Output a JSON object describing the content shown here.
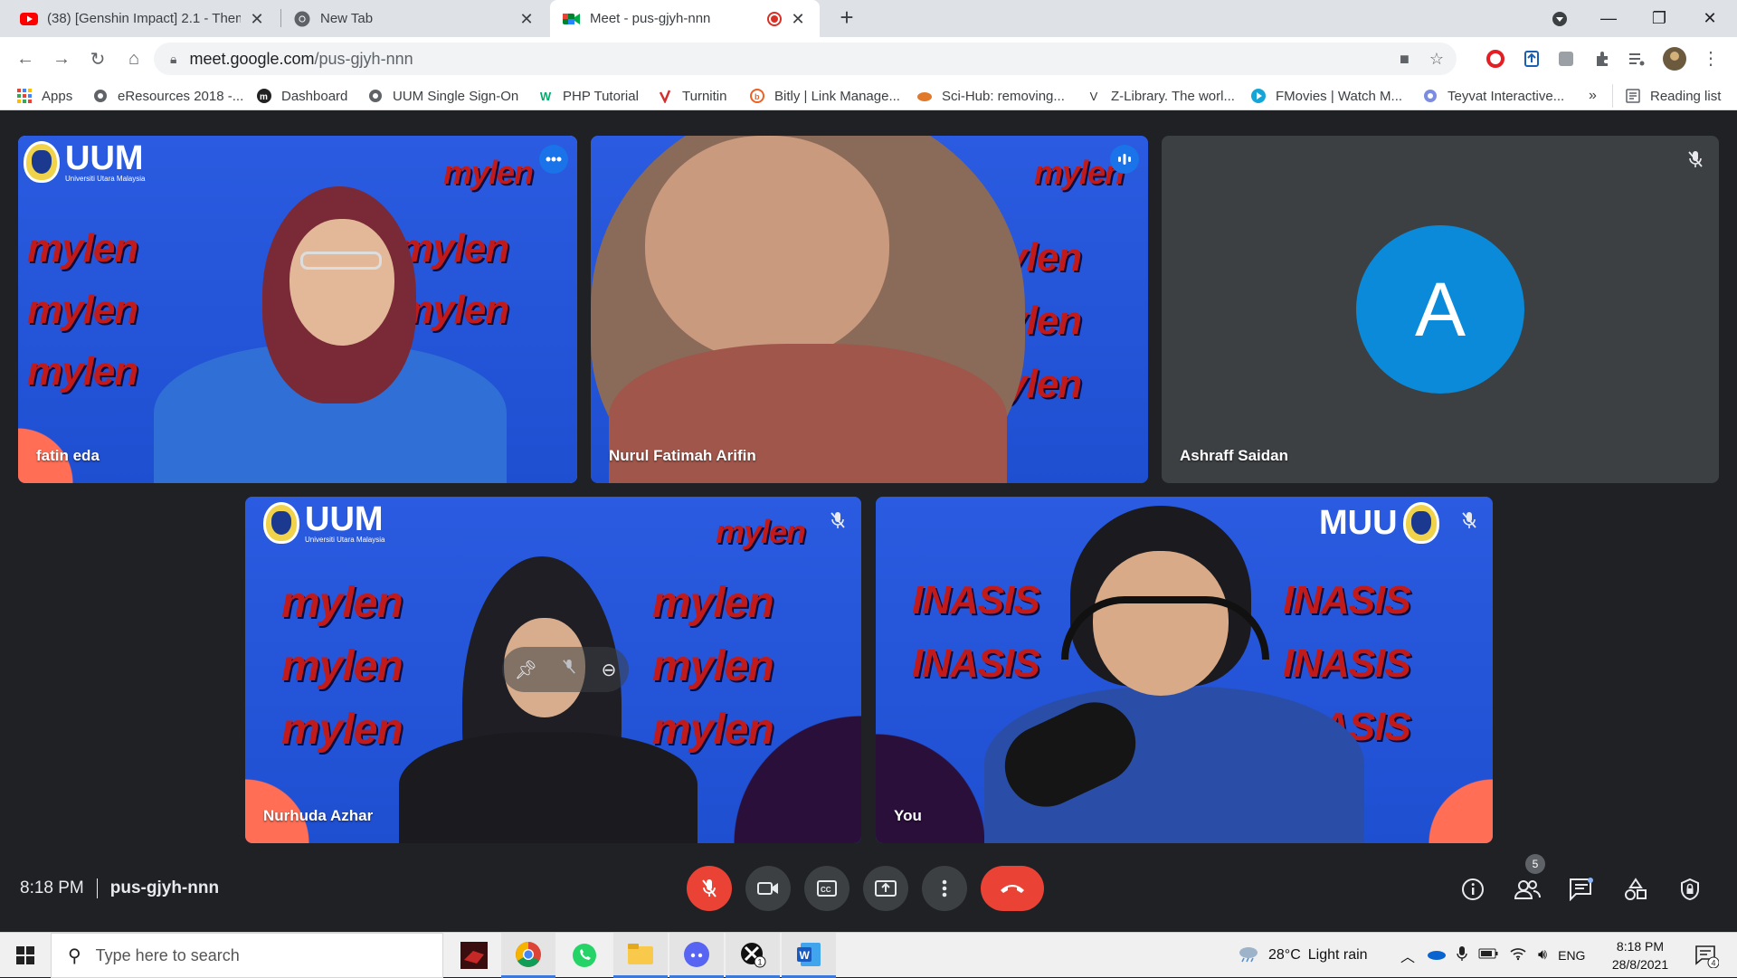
{
  "browser": {
    "tabs": [
      {
        "title": "(38) [Genshin Impact] 2.1 - Them",
        "icon": "youtube-icon",
        "active": false
      },
      {
        "title": "New Tab",
        "icon": "chrome-icon",
        "active": false
      },
      {
        "title": "Meet - pus-gjyh-nnn",
        "icon": "meet-icon",
        "active": true
      }
    ],
    "url_host": "meet.google.com",
    "url_path": "/pus-gjyh-nnn",
    "bookmarks": [
      {
        "label": "Apps",
        "icon": "apps-grid-icon"
      },
      {
        "label": "eResources 2018 -...",
        "icon": "globe-icon"
      },
      {
        "label": "Dashboard",
        "icon": "moodle-icon"
      },
      {
        "label": "UUM Single Sign-On",
        "icon": "globe-icon"
      },
      {
        "label": "PHP Tutorial",
        "icon": "w3schools-icon"
      },
      {
        "label": "Turnitin",
        "icon": "turnitin-icon"
      },
      {
        "label": "Bitly | Link Manage...",
        "icon": "bitly-icon"
      },
      {
        "label": "Sci-Hub: removing...",
        "icon": "scihub-icon"
      },
      {
        "label": "Z-Library. The worl...",
        "icon": "zlibrary-icon"
      },
      {
        "label": "FMovies | Watch M...",
        "icon": "fmovies-icon"
      },
      {
        "label": "Teyvat Interactive...",
        "icon": "teyvat-icon"
      }
    ],
    "more_bookmarks": "»",
    "reading_list": "Reading list"
  },
  "meet": {
    "participants": [
      {
        "name": "fatin eda",
        "active_speaker": true,
        "corner": "more-options-icon"
      },
      {
        "name": "Nurul Fatimah Arifin",
        "active_speaker": false,
        "corner": "speaking-indicator-icon"
      },
      {
        "name": "Ashraff Saidan",
        "active_speaker": false,
        "corner": "mic-off-icon",
        "avatar_letter": "A"
      },
      {
        "name": "Nurhuda Azhar",
        "active_speaker": false,
        "corner": "mic-off-icon"
      },
      {
        "name": "You",
        "active_speaker": false,
        "corner": "mic-off-icon"
      }
    ],
    "backdrop": {
      "logo": "UUM",
      "logo_mirrored": "MUU",
      "logo_sub": "Universiti Utara Malaysia",
      "banner": "mylen",
      "banner_tag": "INASIS"
    },
    "time": "8:18 PM",
    "meeting_code": "pus-gjyh-nnn",
    "people_count": "5",
    "colors": {
      "accent_red": "#ea4335",
      "avatar_blue": "#0b8ad9",
      "speaker_outline": "#8ab4f8"
    }
  },
  "taskbar": {
    "search_placeholder": "Type here to search",
    "weather_temp": "28°C",
    "weather_text": "Light rain",
    "language": "ENG",
    "clock_time": "8:18 PM",
    "clock_date": "28/8/2021",
    "notification_count": "4",
    "xbox_badge": "1"
  }
}
